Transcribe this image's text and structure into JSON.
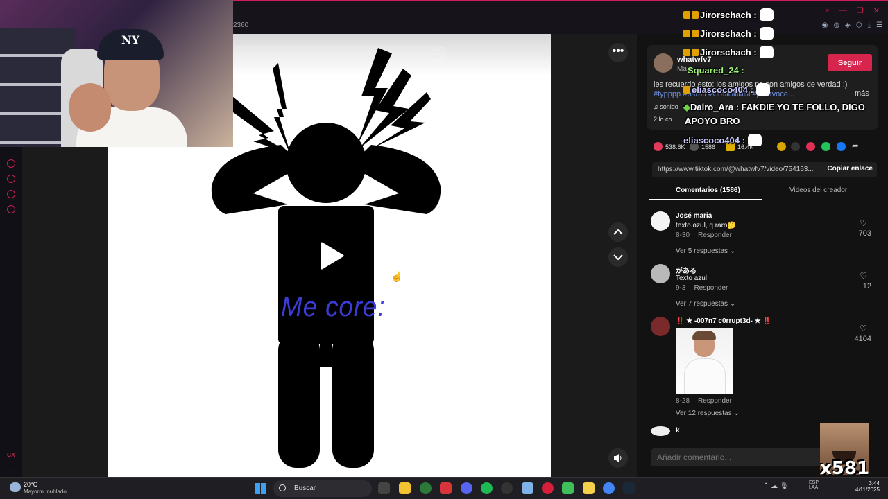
{
  "browser": {
    "page_indicator": "2360"
  },
  "video": {
    "search_placeholder": "car contenido relacionado",
    "overlay_text": "Me core:"
  },
  "post": {
    "username": "whatwfv7",
    "user_sub": "Ma",
    "follow_label": "Seguir",
    "description": "les recuerdo esto: los amigos no son amigos de verdad :)",
    "hashtags": "#fypppp #parati #viralllllllllllllll #paravoce...",
    "more_label": "más",
    "sound_label": "sonido",
    "liked_by": "2 lo co",
    "likes": "538.6K",
    "comments_count": "1586",
    "saves": "16.4K",
    "link_url": "https://www.tiktok.com/@whatwfv7/video/754153...",
    "copy_link_label": "Copiar enlace"
  },
  "tabs": {
    "comments": "Comentarios (1586)",
    "creator_videos": "Videos del creador"
  },
  "comments": [
    {
      "name": "José maria",
      "text": "texto azul, q raro🤔",
      "date": "8-30",
      "reply": "Responder",
      "replies": "Ver 5 respuestas ⌄",
      "likes": "703"
    },
    {
      "name": "がある",
      "text": "Texto azul",
      "date": "9-3",
      "reply": "Responder",
      "replies": "Ver 7 respuestas ⌄",
      "likes": "12"
    },
    {
      "name": "‼️ ★ -007n7 c0rrupt3d- ★ ‼️",
      "text": "",
      "date": "8-28",
      "reply": "Responder",
      "replies": "Ver 12 respuestas ⌄",
      "likes": "4104"
    },
    {
      "name": "k",
      "text": "",
      "date": "",
      "reply": "",
      "replies": "",
      "likes": ""
    }
  ],
  "add_comment_placeholder": "Añadir comentario...",
  "chat": [
    {
      "user": "Jirorschach",
      "msg": ":"
    },
    {
      "user": "Jirorschach",
      "msg": ":"
    },
    {
      "user": "Jirorschach",
      "msg": ":"
    },
    {
      "user": "Squared_24",
      "msg": ":"
    },
    {
      "user": "eliascoco404",
      "msg": ":"
    },
    {
      "user": "Dairo_Ara",
      "msg": ": FAKDIE YO TE FOLLO, DIGO"
    },
    {
      "user": "",
      "msg": "APOYO BRO"
    },
    {
      "user": "eliascoco404",
      "msg": ":"
    }
  ],
  "emote_counter": "x581",
  "taskbar": {
    "temp": "20°C",
    "weather": "Mayorm. nublado",
    "search": "Buscar",
    "lang1": "ESP",
    "lang2": "LAA",
    "time": "3:44",
    "date": "4/11/2025"
  },
  "sidebar": {
    "gx_label": "GX"
  },
  "colors": {
    "accent": "#d8254d",
    "hashtag": "#6e8fe0",
    "video_text": "#3b3bd6"
  }
}
